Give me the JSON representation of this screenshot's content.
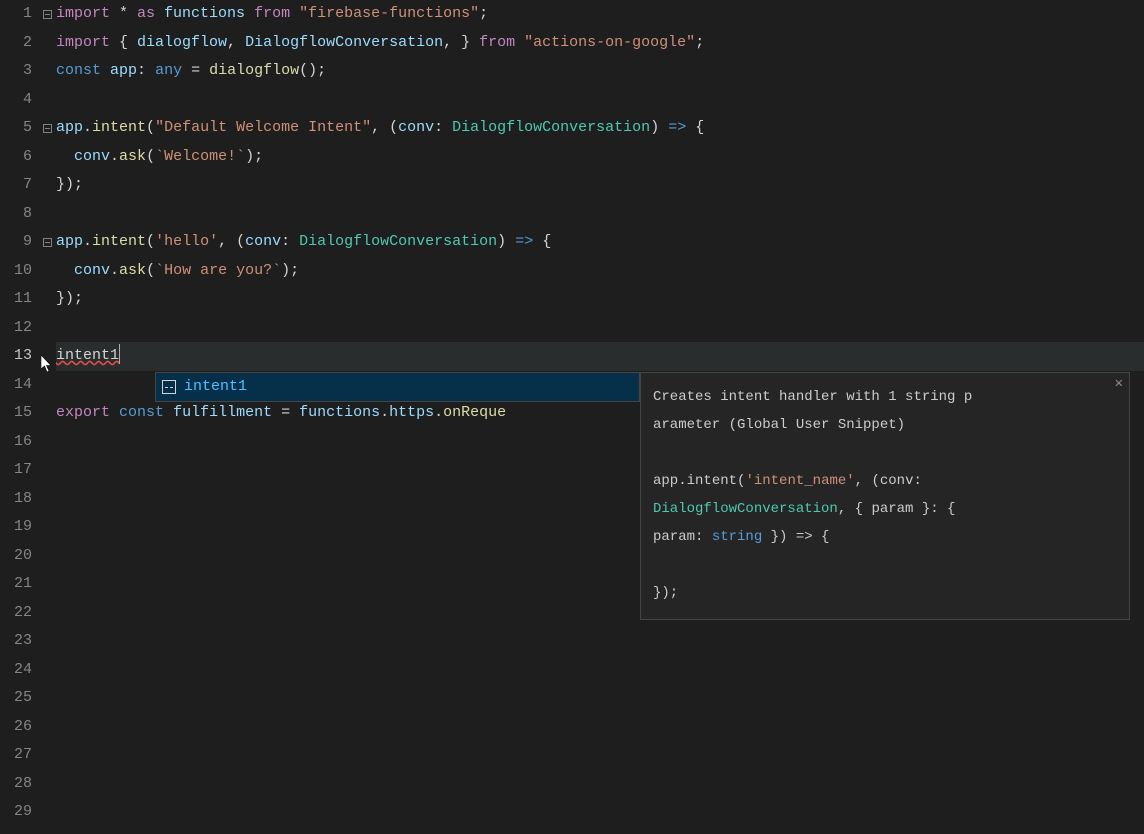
{
  "line_count": 29,
  "current_line": 13,
  "fold_lines": [
    1,
    5,
    9
  ],
  "code": {
    "l1": {
      "a": "import",
      "b": " * ",
      "c": "as",
      "d": " functions ",
      "e": "from",
      "f": " ",
      "g": "\"firebase-functions\"",
      "h": ";"
    },
    "l2": {
      "a": "import",
      "b": " { ",
      "c": "dialogflow",
      "d": ", ",
      "e": "DialogflowConversation",
      "f": ", } ",
      "g": "from",
      "h": " ",
      "i": "\"actions-on-google\"",
      "j": ";"
    },
    "l3": {
      "a": "const",
      "b": " ",
      "c": "app",
      "d": ": ",
      "e": "any",
      "f": " = ",
      "g": "dialogflow",
      "h": "();"
    },
    "l5": {
      "a": "app",
      "b": ".",
      "c": "intent",
      "d": "(",
      "e": "\"Default Welcome Intent\"",
      "f": ", (",
      "g": "conv",
      "h": ": ",
      "i": "DialogflowConversation",
      "j": ") ",
      "k": "=>",
      "l": " {"
    },
    "l6": {
      "indent": "  ",
      "a": "conv",
      "b": ".",
      "c": "ask",
      "d": "(",
      "e": "`Welcome!`",
      "f": ");"
    },
    "l7": {
      "a": "});"
    },
    "l9": {
      "a": "app",
      "b": ".",
      "c": "intent",
      "d": "(",
      "e": "'hello'",
      "f": ", (",
      "g": "conv",
      "h": ": ",
      "i": "DialogflowConversation",
      "j": ") ",
      "k": "=>",
      "l": " {"
    },
    "l10": {
      "indent": "  ",
      "a": "conv",
      "b": ".",
      "c": "ask",
      "d": "(",
      "e": "`How are you?`",
      "f": ");"
    },
    "l11": {
      "a": "});"
    },
    "l13": {
      "text": "intent1"
    },
    "l15": {
      "a": "export",
      "b": " ",
      "c": "const",
      "d": " ",
      "e": "fulfillment",
      "f": " = ",
      "g": "functions",
      "h": ".",
      "i": "https",
      "j": ".",
      "k": "onReque"
    }
  },
  "suggest": {
    "label": "intent1"
  },
  "docs": {
    "l1": "Creates intent handler with 1 string p",
    "l2": "arameter (Global User Snippet)",
    "s1a": "app",
    "s1b": ".",
    "s1c": "intent",
    "s1d": "(",
    "s1e": "'intent_name'",
    "s1f": ", (conv: ",
    "s2a": "DialogflowConversation",
    "s2b": ", { param }: { ",
    "s3a": "param: ",
    "s3b": "string",
    "s3c": " }) => {",
    "s4": "});"
  }
}
